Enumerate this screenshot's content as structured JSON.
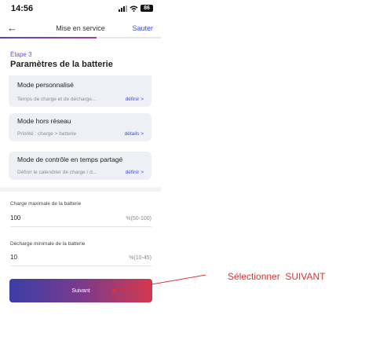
{
  "status_bar": {
    "time": "14:56",
    "battery": "86"
  },
  "nav": {
    "title": "Mise en service",
    "skip_label": "Sauter",
    "progress": 0.6
  },
  "step_label": "Étape 3",
  "page_title": "Paramètres de la batterie",
  "modes": [
    {
      "title": "Mode personnalisé",
      "description": "Temps de charge et de décharge...",
      "action": "définir >"
    },
    {
      "title": "Mode hors réseau",
      "description": "Priorité : charge > batterie",
      "action": "détails >"
    },
    {
      "title": "Mode de contrôle en temps partagé",
      "description": "Définir le calendrier de charge / d...",
      "action": "définir >"
    }
  ],
  "fields": [
    {
      "label": "Charge maximale de la batterie",
      "value": "100",
      "range": "%(50-100)"
    },
    {
      "label": "Décharge minimale de la batterie",
      "value": "10",
      "range": "%(10-45)"
    }
  ],
  "next_button_label": "Suivant",
  "annotation": "Sélectionner  SUIVANT",
  "colors": {
    "accent": "#3d4fd8",
    "button_gradient_start": "#3b3ea8",
    "button_gradient_end": "#d2394f",
    "annotation": "#e03030"
  }
}
